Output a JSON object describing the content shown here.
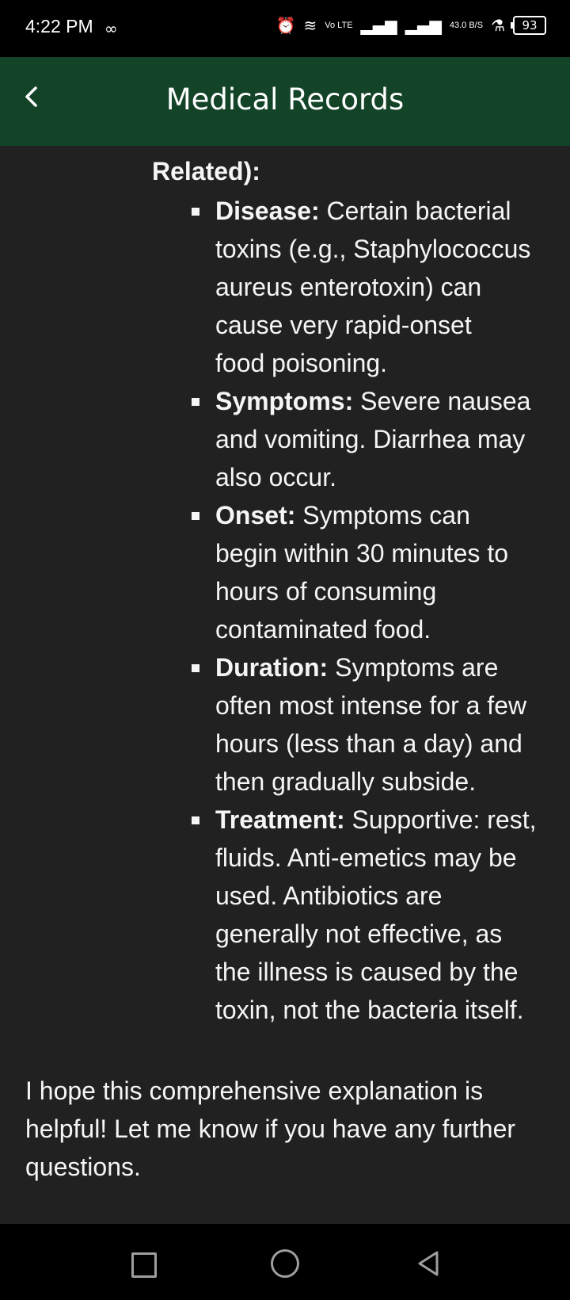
{
  "status_bar": {
    "time": "4:22 PM",
    "lte": "Vo LTE",
    "speed": "43.0 B/S",
    "battery": "93"
  },
  "app_bar": {
    "title": "Medical Records"
  },
  "content": {
    "heading": "Related):",
    "bullets": [
      {
        "label": "Disease:",
        "lines": [
          "Certain bacterial",
          "toxins (e.g., Staphylococcus",
          "aureus enterotoxin) can",
          "cause very rapid-onset",
          "food poisoning."
        ]
      },
      {
        "label": "Symptoms:",
        "lines": [
          "Severe nausea",
          "and vomiting. Diarrhea may",
          "also occur."
        ]
      },
      {
        "label": "Onset:",
        "lines": [
          "Symptoms can",
          "begin within 30 minutes to",
          "hours of consuming",
          "contaminated food."
        ]
      },
      {
        "label": "Duration:",
        "lines": [
          "Symptoms are",
          "often most intense for a few",
          "hours (less than a day) and",
          "then gradually subside."
        ]
      },
      {
        "label": "Treatment:",
        "lines": [
          "Supportive: rest,",
          "fluids. Anti-emetics may be",
          "used. Antibiotics are",
          "generally not effective, as",
          "the illness is caused by the",
          "toxin, not the bacteria itself."
        ]
      }
    ],
    "closing": [
      "I hope this comprehensive explanation is",
      "helpful! Let me know if you have any further",
      "questions."
    ]
  }
}
